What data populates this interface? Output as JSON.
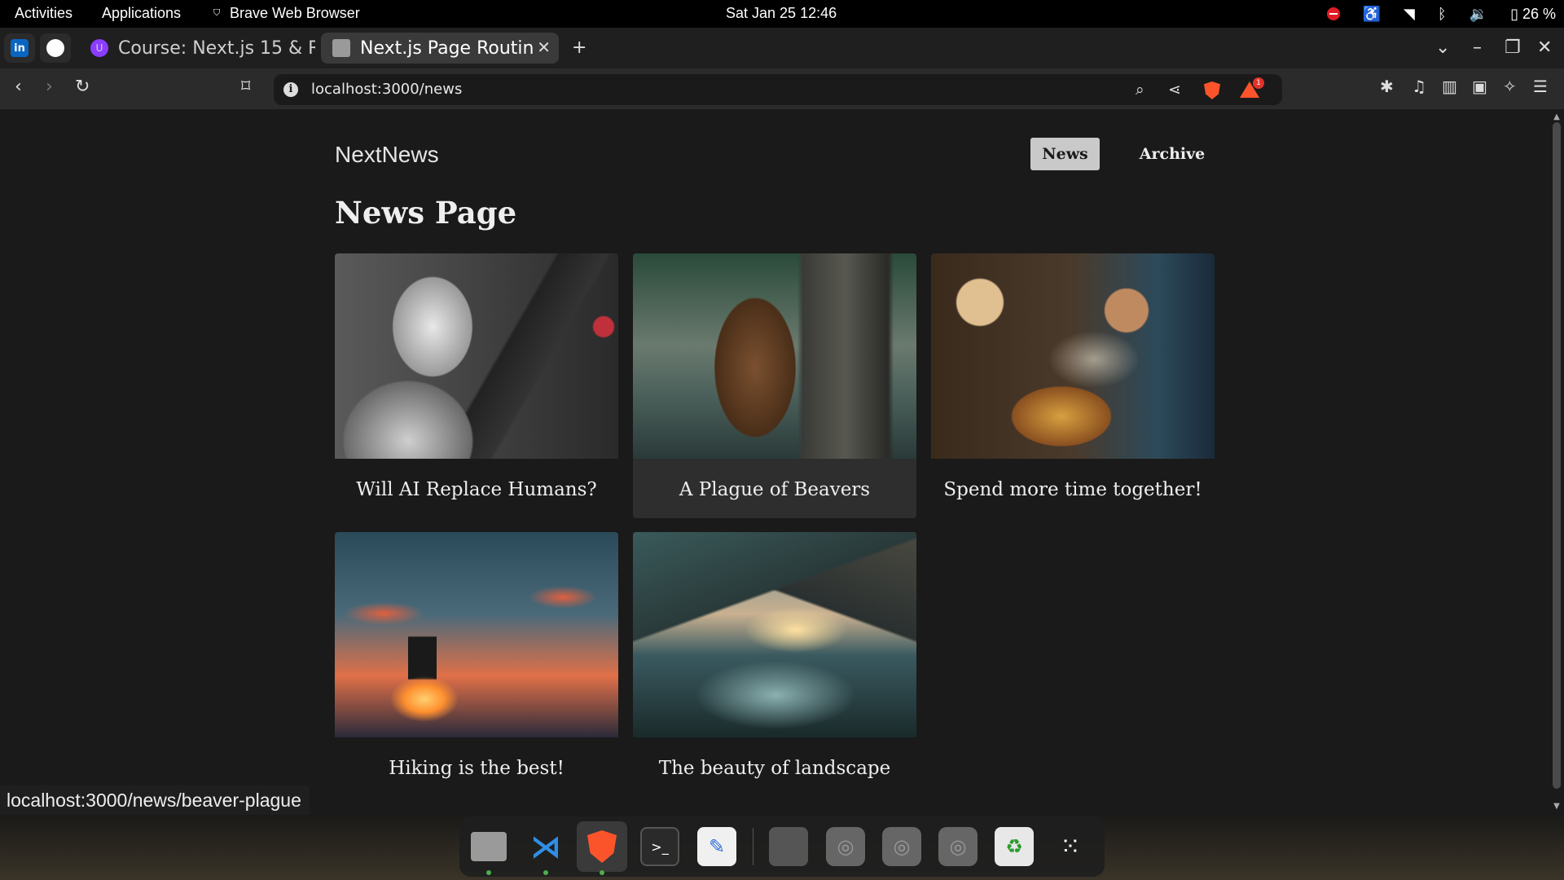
{
  "system": {
    "activities": "Activities",
    "applications": "Applications",
    "active_app": "Brave Web Browser",
    "datetime": "Sat Jan 25  12:46",
    "battery": "26 %"
  },
  "tabs": [
    {
      "label": "Course: Next.js 15 & R",
      "icon": "course-favicon"
    },
    {
      "label": "Next.js Page Routin",
      "icon": "nextjs-favicon",
      "active": true
    }
  ],
  "pinned_tabs": [
    "linkedin-icon",
    "github-icon"
  ],
  "address": {
    "url": "localhost:3000/news"
  },
  "site": {
    "logo": "NextNews",
    "nav": {
      "news": "News",
      "archive": "Archive"
    },
    "heading": "News Page",
    "articles": [
      {
        "title": "Will AI Replace Humans?",
        "image": "robot-with-tablet"
      },
      {
        "title": "A Plague of Beavers",
        "image": "beaver-on-tree"
      },
      {
        "title": "Spend more time together!",
        "image": "couple-cooking"
      },
      {
        "title": "Hiking is the best!",
        "image": "hiker-at-sunset"
      },
      {
        "title": "The beauty of landscape",
        "image": "mountain-lake"
      }
    ]
  },
  "status_url": "localhost:3000/news/beaver-plague",
  "colors": {
    "brave_orange": "#fb542b",
    "page_bg": "#1a1a1a",
    "nav_active_bg": "#c9c9c9"
  }
}
